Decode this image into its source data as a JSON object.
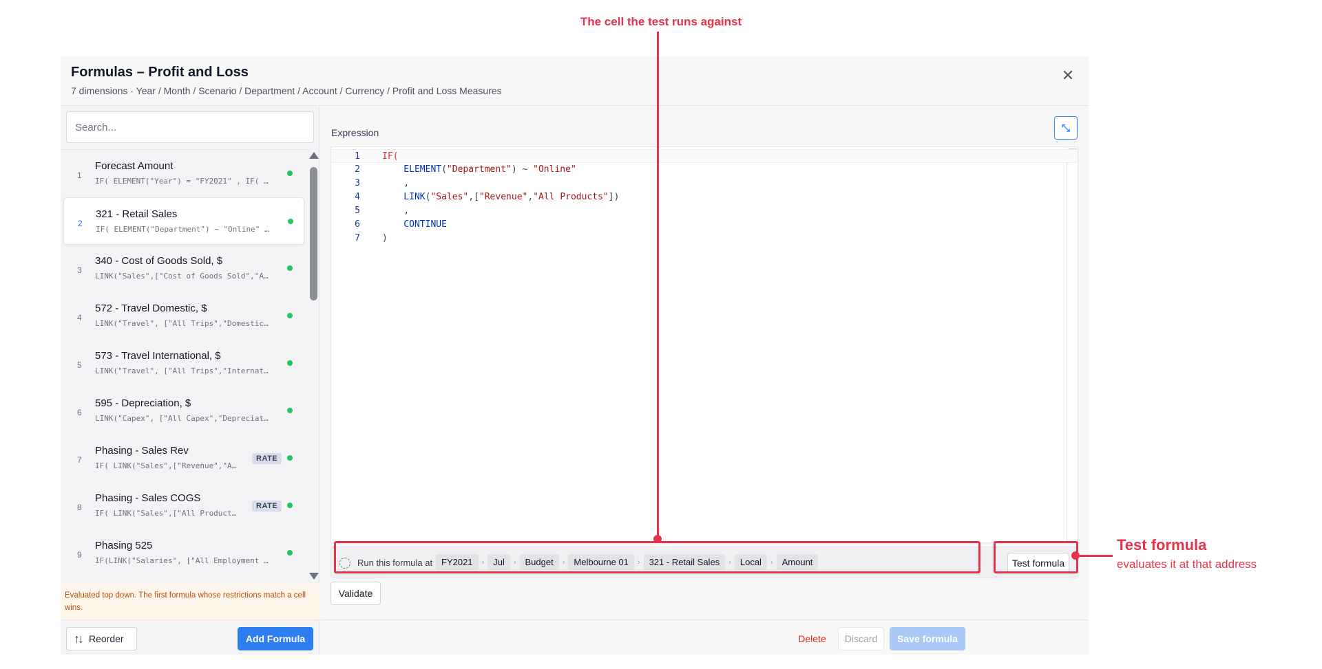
{
  "annotations": {
    "top_label": "The cell the test runs against",
    "right_title": "Test formula",
    "right_subtitle": "evaluates it at that address"
  },
  "dialog": {
    "title": "Formulas – Profit and Loss",
    "subtitle": "7 dimensions · Year / Month / Scenario / Department / Account / Currency / Profit and Loss Measures",
    "close_icon": "close-icon"
  },
  "sidebar": {
    "search_placeholder": "Search...",
    "items": [
      {
        "num": "1",
        "title": "Forecast Amount",
        "expr": "IF( ELEMENT(\"Year\") = \"FY2021\" , IF( …",
        "badge": ""
      },
      {
        "num": "2",
        "title": "321 - Retail Sales",
        "expr": "IF( ELEMENT(\"Department\") ~ \"Online\" …",
        "badge": "",
        "selected": true
      },
      {
        "num": "3",
        "title": "340 - Cost of Goods Sold, $",
        "expr": "LINK(\"Sales\",[\"Cost of Goods Sold\",\"A…",
        "badge": ""
      },
      {
        "num": "4",
        "title": "572 - Travel Domestic, $",
        "expr": "LINK(\"Travel\", [\"All Trips\",\"Domestic…",
        "badge": ""
      },
      {
        "num": "5",
        "title": "573 - Travel International, $",
        "expr": "LINK(\"Travel\", [\"All Trips\",\"Internat…",
        "badge": ""
      },
      {
        "num": "6",
        "title": "595 - Depreciation, $",
        "expr": "LINK(\"Capex\", [\"All Capex\",\"Depreciat…",
        "badge": ""
      },
      {
        "num": "7",
        "title": "Phasing - Sales Rev",
        "expr": "IF( LINK(\"Sales\",[\"Revenue\",\"A…",
        "badge": "RATE"
      },
      {
        "num": "8",
        "title": "Phasing - Sales COGS",
        "expr": "IF( LINK(\"Sales\",[\"All Product…",
        "badge": "RATE"
      },
      {
        "num": "9",
        "title": "Phasing 525",
        "expr": "IF(LINK(\"Salaries\", [\"All Employment …",
        "badge": ""
      }
    ],
    "note": "Evaluated top down. The first formula whose restrictions match a cell wins.",
    "reorder_label": "Reorder",
    "add_label": "Add Formula"
  },
  "editor": {
    "label": "Expression",
    "lines": [
      {
        "n": "1",
        "segments": [
          {
            "t": "IF",
            "c": "kw-red"
          },
          {
            "t": "(",
            "c": "kw-red"
          }
        ]
      },
      {
        "n": "2",
        "segments": [
          {
            "t": "    ELEMENT",
            "c": "kw-blue"
          },
          {
            "t": "(",
            "c": "plain"
          },
          {
            "t": "\"Department\"",
            "c": "str"
          },
          {
            "t": ") ~ ",
            "c": "plain"
          },
          {
            "t": "\"Online\"",
            "c": "str"
          }
        ]
      },
      {
        "n": "3",
        "segments": [
          {
            "t": "    ,",
            "c": "plain"
          }
        ]
      },
      {
        "n": "4",
        "segments": [
          {
            "t": "    LINK",
            "c": "kw-blue"
          },
          {
            "t": "(",
            "c": "plain"
          },
          {
            "t": "\"Sales\"",
            "c": "str"
          },
          {
            "t": ",[",
            "c": "plain"
          },
          {
            "t": "\"Revenue\"",
            "c": "str"
          },
          {
            "t": ",",
            "c": "plain"
          },
          {
            "t": "\"All Products\"",
            "c": "str"
          },
          {
            "t": "])",
            "c": "plain"
          }
        ]
      },
      {
        "n": "5",
        "segments": [
          {
            "t": "    ,",
            "c": "plain"
          }
        ]
      },
      {
        "n": "6",
        "segments": [
          {
            "t": "    CONTINUE",
            "c": "kw-blue"
          }
        ]
      },
      {
        "n": "7",
        "segments": [
          {
            "t": ")",
            "c": "plain"
          }
        ]
      }
    ]
  },
  "runbar": {
    "label": "Run this formula at",
    "chips": [
      "FY2021",
      "Jul",
      "Budget",
      "Melbourne 01",
      "321 - Retail Sales",
      "Local",
      "Amount"
    ],
    "test_label": "Test formula"
  },
  "actions": {
    "validate_label": "Validate",
    "delete_label": "Delete",
    "discard_label": "Discard",
    "save_label": "Save formula"
  },
  "colors": {
    "accent": "#2f7ef0",
    "annotation": "#e5344a",
    "status_green": "#22c55e",
    "danger": "#dc2626"
  }
}
